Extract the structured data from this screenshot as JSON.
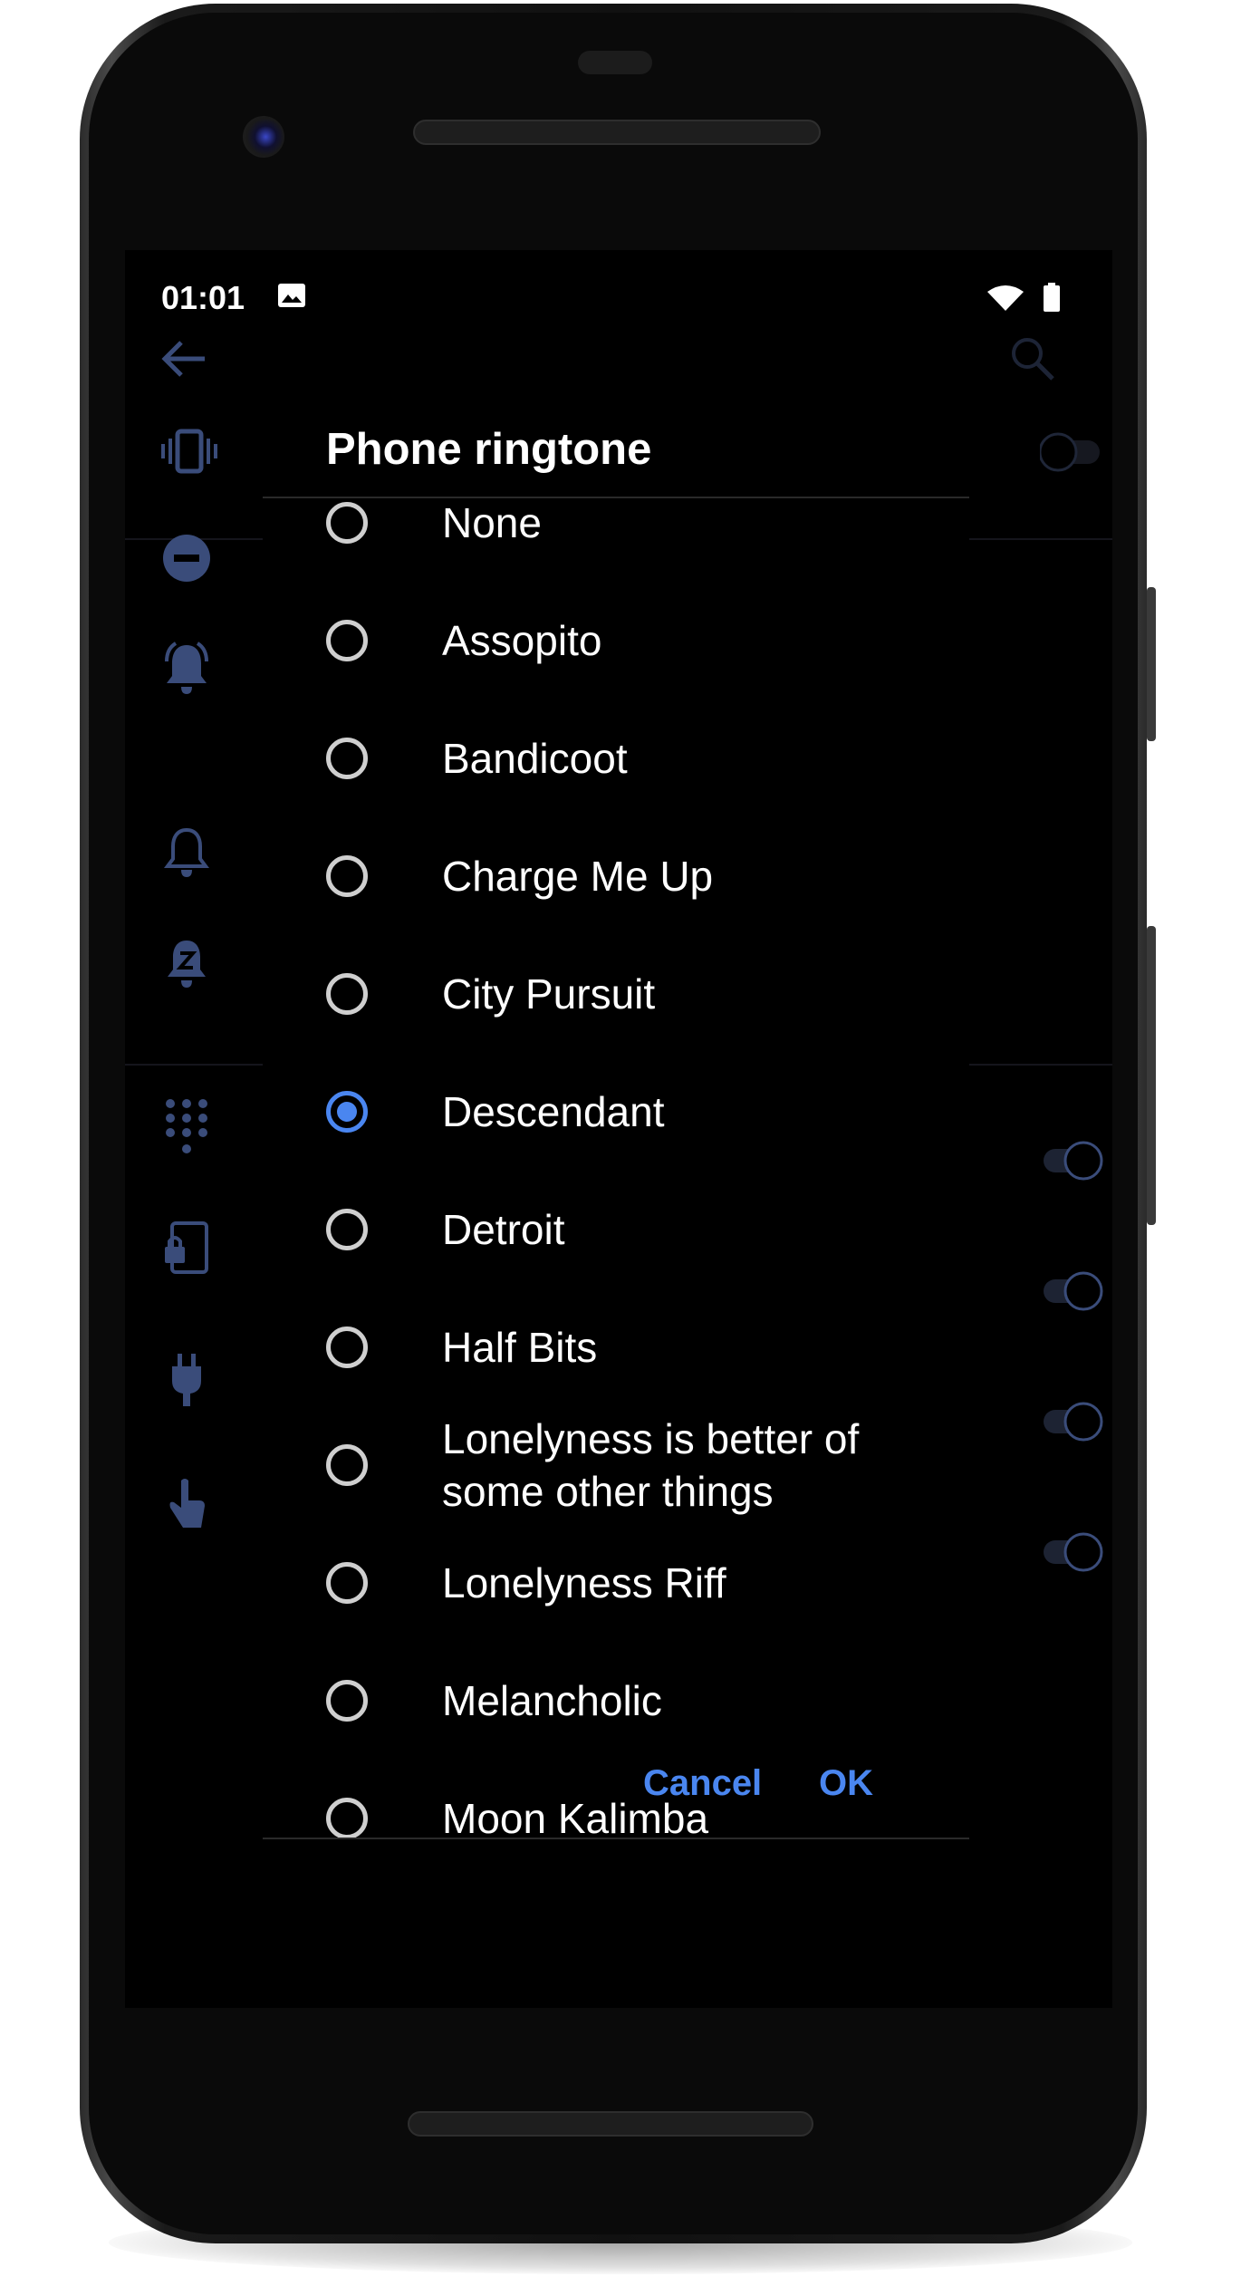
{
  "status_bar": {
    "time": "01:01"
  },
  "dialog": {
    "title": "Phone ringtone",
    "options": [
      {
        "label": "None",
        "selected": false
      },
      {
        "label": "Assopito",
        "selected": false
      },
      {
        "label": "Bandicoot",
        "selected": false
      },
      {
        "label": "Charge Me Up",
        "selected": false
      },
      {
        "label": "City Pursuit",
        "selected": false
      },
      {
        "label": "Descendant",
        "selected": true
      },
      {
        "label": "Detroit",
        "selected": false
      },
      {
        "label": "Half Bits",
        "selected": false
      },
      {
        "label": "Lonelyness is better of some other things",
        "selected": false
      },
      {
        "label": "Lonelyness Riff",
        "selected": false
      },
      {
        "label": "Melancholic",
        "selected": false
      },
      {
        "label": "Moon Kalimba",
        "selected": false
      }
    ],
    "cancel_label": "Cancel",
    "ok_label": "OK"
  },
  "colors": {
    "accent": "#4a86f0",
    "dim_accent": "#3a4c7a",
    "background": "#000000"
  },
  "icons": {
    "status": [
      "image-icon",
      "wifi-icon",
      "battery-icon"
    ],
    "background": [
      "back-arrow-icon",
      "search-icon",
      "vibrate-icon",
      "do-not-disturb-icon",
      "ringing-bell-icon",
      "bell-icon",
      "snooze-bell-icon",
      "dialpad-icon",
      "screen-lock-icon",
      "charging-plug-icon",
      "touch-icon"
    ]
  }
}
